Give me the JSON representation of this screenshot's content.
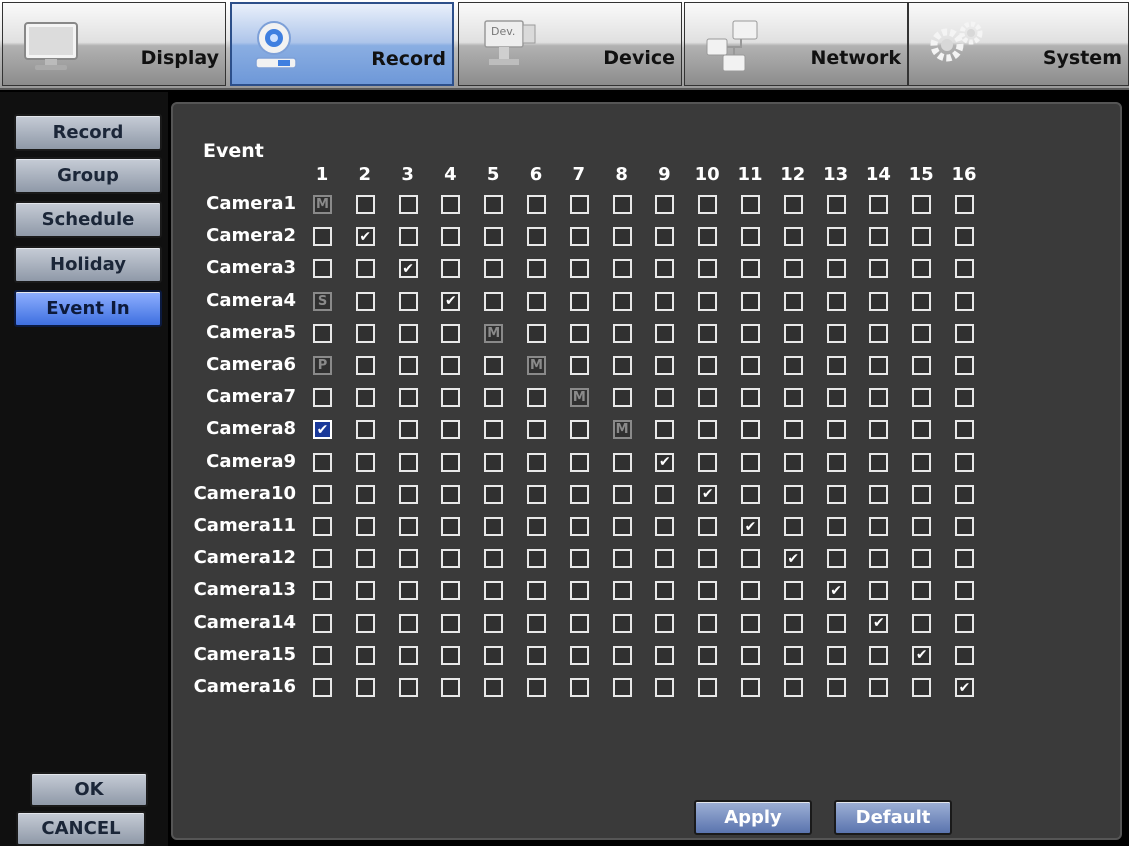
{
  "tabs": [
    {
      "label": "Display",
      "icon": "monitor-icon",
      "active": false
    },
    {
      "label": "Record",
      "icon": "webcam-icon",
      "active": true
    },
    {
      "label": "Device",
      "icon": "camera-device-icon",
      "active": false
    },
    {
      "label": "Network",
      "icon": "network-icon",
      "active": false
    },
    {
      "label": "System",
      "icon": "gears-icon",
      "active": false
    }
  ],
  "device_icon_text": "Dev.",
  "side_menu": [
    {
      "label": "Record",
      "active": false
    },
    {
      "label": "Group",
      "active": false
    },
    {
      "label": "Schedule",
      "active": false
    },
    {
      "label": "Holiday",
      "active": false
    },
    {
      "label": "Event In",
      "active": true
    }
  ],
  "grid": {
    "title": "Event",
    "columns": [
      "1",
      "2",
      "3",
      "4",
      "5",
      "6",
      "7",
      "8",
      "9",
      "10",
      "11",
      "12",
      "13",
      "14",
      "15",
      "16"
    ],
    "rows": [
      {
        "label": "Camera1",
        "cells": [
          "M",
          "",
          "",
          "",
          "",
          "",
          "",
          "",
          "",
          "",
          "",
          "",
          "",
          "",
          "",
          ""
        ]
      },
      {
        "label": "Camera2",
        "cells": [
          "",
          "✔",
          "",
          "",
          "",
          "",
          "",
          "",
          "",
          "",
          "",
          "",
          "",
          "",
          "",
          ""
        ]
      },
      {
        "label": "Camera3",
        "cells": [
          "",
          "",
          "✔",
          "",
          "",
          "",
          "",
          "",
          "",
          "",
          "",
          "",
          "",
          "",
          "",
          ""
        ]
      },
      {
        "label": "Camera4",
        "cells": [
          "S",
          "",
          "",
          "✔",
          "",
          "",
          "",
          "",
          "",
          "",
          "",
          "",
          "",
          "",
          "",
          ""
        ]
      },
      {
        "label": "Camera5",
        "cells": [
          "",
          "",
          "",
          "",
          "M",
          "",
          "",
          "",
          "",
          "",
          "",
          "",
          "",
          "",
          "",
          ""
        ]
      },
      {
        "label": "Camera6",
        "cells": [
          "P",
          "",
          "",
          "",
          "",
          "M",
          "",
          "",
          "",
          "",
          "",
          "",
          "",
          "",
          "",
          ""
        ]
      },
      {
        "label": "Camera7",
        "cells": [
          "",
          "",
          "",
          "",
          "",
          "",
          "M",
          "",
          "",
          "",
          "",
          "",
          "",
          "",
          "",
          ""
        ]
      },
      {
        "label": "Camera8",
        "cells": [
          "✔*",
          "",
          "",
          "",
          "",
          "",
          "",
          "M",
          "",
          "",
          "",
          "",
          "",
          "",
          "",
          ""
        ]
      },
      {
        "label": "Camera9",
        "cells": [
          "",
          "",
          "",
          "",
          "",
          "",
          "",
          "",
          "✔",
          "",
          "",
          "",
          "",
          "",
          "",
          ""
        ]
      },
      {
        "label": "Camera10",
        "cells": [
          "",
          "",
          "",
          "",
          "",
          "",
          "",
          "",
          "",
          "✔",
          "",
          "",
          "",
          "",
          "",
          ""
        ]
      },
      {
        "label": "Camera11",
        "cells": [
          "",
          "",
          "",
          "",
          "",
          "",
          "",
          "",
          "",
          "",
          "✔",
          "",
          "",
          "",
          "",
          ""
        ]
      },
      {
        "label": "Camera12",
        "cells": [
          "",
          "",
          "",
          "",
          "",
          "",
          "",
          "",
          "",
          "",
          "",
          "✔",
          "",
          "",
          "",
          ""
        ]
      },
      {
        "label": "Camera13",
        "cells": [
          "",
          "",
          "",
          "",
          "",
          "",
          "",
          "",
          "",
          "",
          "",
          "",
          "✔",
          "",
          "",
          ""
        ]
      },
      {
        "label": "Camera14",
        "cells": [
          "",
          "",
          "",
          "",
          "",
          "",
          "",
          "",
          "",
          "",
          "",
          "",
          "",
          "✔",
          "",
          ""
        ]
      },
      {
        "label": "Camera15",
        "cells": [
          "",
          "",
          "",
          "",
          "",
          "",
          "",
          "",
          "",
          "",
          "",
          "",
          "",
          "",
          "✔",
          ""
        ]
      },
      {
        "label": "Camera16",
        "cells": [
          "",
          "",
          "",
          "",
          "",
          "",
          "",
          "",
          "",
          "",
          "",
          "",
          "",
          "",
          "",
          "✔"
        ]
      }
    ]
  },
  "buttons": {
    "ok": "OK",
    "cancel": "CANCEL",
    "apply": "Apply",
    "default": "Default"
  }
}
